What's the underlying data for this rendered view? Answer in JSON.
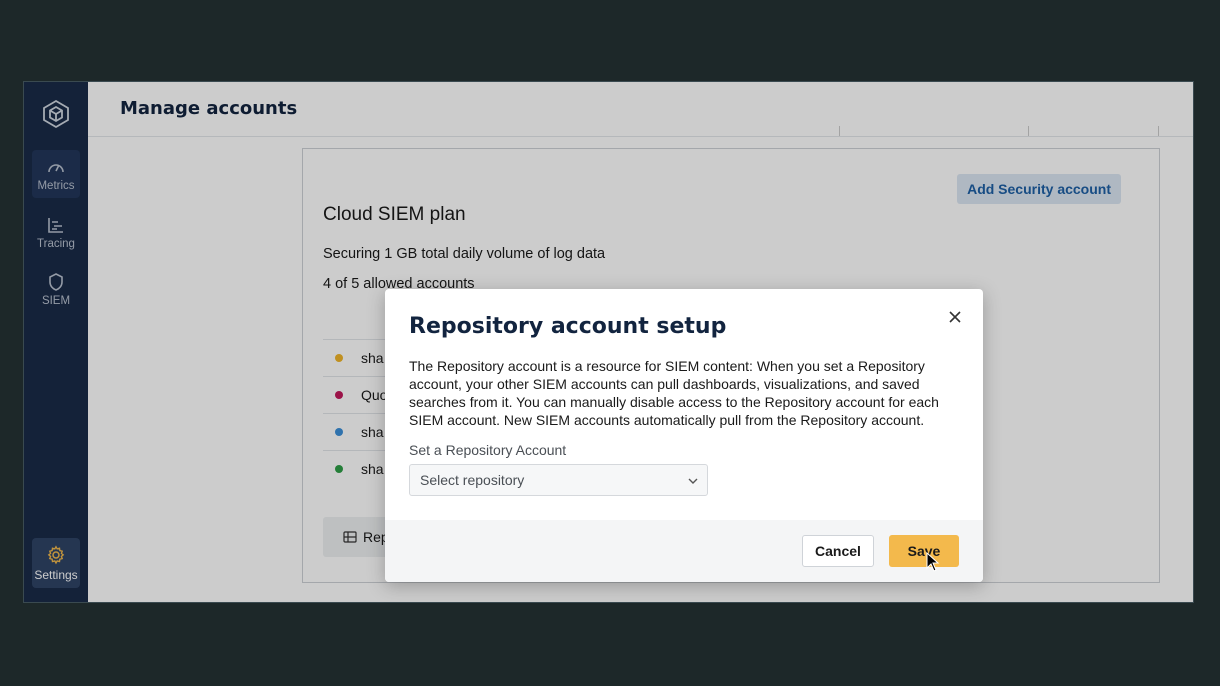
{
  "header": {
    "title": "Manage accounts"
  },
  "sidebar": {
    "items": [
      {
        "label": "Metrics",
        "icon": "gauge-icon"
      },
      {
        "label": "Tracing",
        "icon": "tracing-icon"
      },
      {
        "label": "SIEM",
        "icon": "shield-icon"
      },
      {
        "label": "Settings",
        "icon": "gear-icon"
      }
    ]
  },
  "plan": {
    "add_button": "Add Security account",
    "title": "Cloud SIEM plan",
    "volume": "Securing 1 GB total daily volume of log data",
    "allowed": "4 of 5 allowed accounts",
    "accounts": [
      {
        "label": "sha",
        "color": "#f0b429"
      },
      {
        "label": "Quo",
        "color": "#c2185b"
      },
      {
        "label": "sha",
        "color": "#3b8fd9"
      },
      {
        "label": "sha",
        "color": "#2e9e47"
      }
    ],
    "repo_button": "Rep"
  },
  "modal": {
    "title": "Repository account setup",
    "description": "The Repository account is a resource for SIEM content: When you set a Repository account, your other SIEM accounts can pull dashboards, visualizations, and saved searches from it. You can manually disable access to the Repository account for each SIEM account. New SIEM accounts automatically pull from the Repository account.",
    "field_label": "Set a Repository Account",
    "select_placeholder": "Select repository",
    "cancel": "Cancel",
    "save": "Save"
  },
  "colors": {
    "accent": "#f3b94c",
    "sidebar": "#1a2b48",
    "link": "#1d5fa5"
  }
}
